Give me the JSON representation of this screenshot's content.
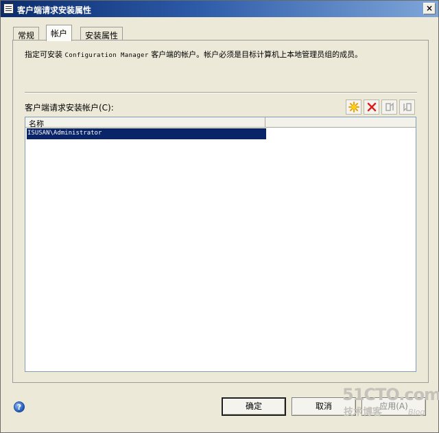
{
  "window": {
    "title": "客户端请求安装属性",
    "close_glyph": "×"
  },
  "tabs": [
    {
      "label": "常规"
    },
    {
      "label": "帐户"
    },
    {
      "label": "安装属性"
    }
  ],
  "panel": {
    "description_prefix": "指定可安装",
    "description_product": "Configuration Manager",
    "description_suffix": "客户端的帐户。帐户必须是目标计算机上本地管理员组的成员。",
    "list_label": "客户端请求安装帐户(C):",
    "toolbar": [
      {
        "name": "new-account",
        "icon": "starburst-icon",
        "enabled": true
      },
      {
        "name": "delete-account",
        "icon": "red-x-icon",
        "enabled": true
      },
      {
        "name": "move-up",
        "icon": "move-up-icon",
        "enabled": false
      },
      {
        "name": "move-down",
        "icon": "move-down-icon",
        "enabled": false
      }
    ],
    "list": {
      "columns": [
        "名称",
        ""
      ],
      "rows": [
        "ISUSAN\\Administrator"
      ]
    }
  },
  "footer": {
    "help_glyph": "?",
    "ok_label": "确定",
    "cancel_label": "取消",
    "apply_label": "应用(A)"
  },
  "watermark": {
    "site": "51CTO.com",
    "line2": "技术博客",
    "blog": "Blog"
  },
  "colors": {
    "selection": "#0a246a",
    "title_gradient_start": "#0b2c6e",
    "dialog_bg": "#ece9d8"
  }
}
